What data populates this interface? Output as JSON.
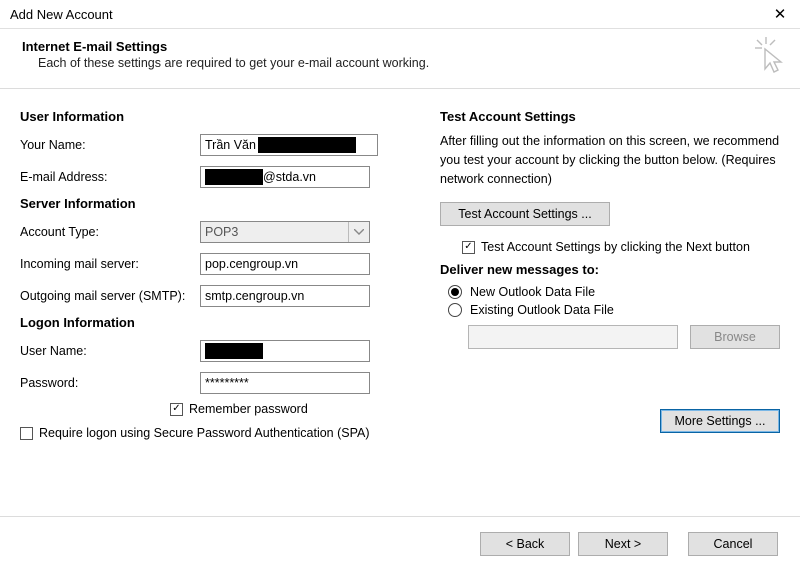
{
  "window": {
    "title": "Add New Account"
  },
  "header": {
    "title": "Internet E-mail Settings",
    "subtitle": "Each of these settings are required to get your e-mail account working."
  },
  "left": {
    "user_info_title": "User Information",
    "your_name_label": "Your Name:",
    "your_name_value_prefix": "Trần Văn",
    "email_label": "E-mail Address:",
    "email_value_suffix": "@stda.vn",
    "server_info_title": "Server Information",
    "account_type_label": "Account Type:",
    "account_type_value": "POP3",
    "incoming_label": "Incoming mail server:",
    "incoming_value": "pop.cengroup.vn",
    "outgoing_label": "Outgoing mail server (SMTP):",
    "outgoing_value": "smtp.cengroup.vn",
    "logon_info_title": "Logon Information",
    "username_label": "User Name:",
    "password_label": "Password:",
    "password_value": "*********",
    "remember_label": "Remember password",
    "spa_label": "Require logon using Secure Password Authentication (SPA)"
  },
  "right": {
    "test_title": "Test Account Settings",
    "test_text": "After filling out the information on this screen, we recommend you test your account by clicking the button below. (Requires network connection)",
    "test_btn": "Test Account Settings ...",
    "test_next_label": "Test Account Settings by clicking the Next button",
    "deliver_title": "Deliver new messages to:",
    "radio_new": "New Outlook Data File",
    "radio_existing": "Existing Outlook Data File",
    "browse_btn": "Browse",
    "more_settings_btn": "More Settings ..."
  },
  "footer": {
    "back": "< Back",
    "next": "Next >",
    "cancel": "Cancel"
  }
}
